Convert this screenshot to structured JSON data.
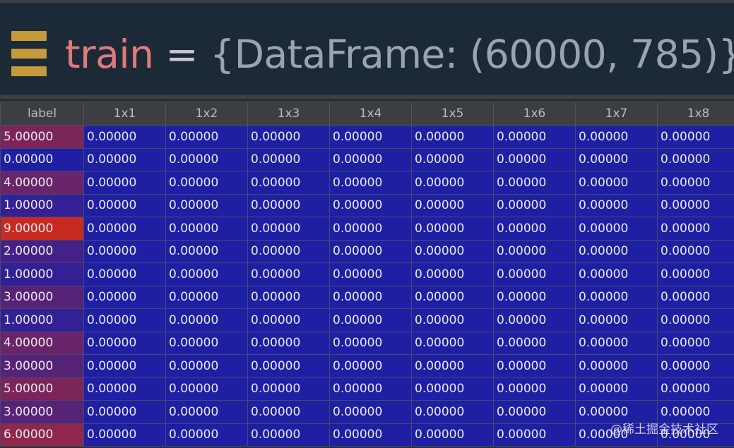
{
  "header": {
    "var_name": "train",
    "operator": "=",
    "value": "{DataFrame: (60000, 785)}"
  },
  "grid": {
    "columns": [
      "label",
      "1x1",
      "1x2",
      "1x3",
      "1x4",
      "1x5",
      "1x6",
      "1x7",
      "1x8"
    ],
    "rows": [
      [
        "5.00000",
        "0.00000",
        "0.00000",
        "0.00000",
        "0.00000",
        "0.00000",
        "0.00000",
        "0.00000",
        "0.00000"
      ],
      [
        "0.00000",
        "0.00000",
        "0.00000",
        "0.00000",
        "0.00000",
        "0.00000",
        "0.00000",
        "0.00000",
        "0.00000"
      ],
      [
        "4.00000",
        "0.00000",
        "0.00000",
        "0.00000",
        "0.00000",
        "0.00000",
        "0.00000",
        "0.00000",
        "0.00000"
      ],
      [
        "1.00000",
        "0.00000",
        "0.00000",
        "0.00000",
        "0.00000",
        "0.00000",
        "0.00000",
        "0.00000",
        "0.00000"
      ],
      [
        "9.00000",
        "0.00000",
        "0.00000",
        "0.00000",
        "0.00000",
        "0.00000",
        "0.00000",
        "0.00000",
        "0.00000"
      ],
      [
        "2.00000",
        "0.00000",
        "0.00000",
        "0.00000",
        "0.00000",
        "0.00000",
        "0.00000",
        "0.00000",
        "0.00000"
      ],
      [
        "1.00000",
        "0.00000",
        "0.00000",
        "0.00000",
        "0.00000",
        "0.00000",
        "0.00000",
        "0.00000",
        "0.00000"
      ],
      [
        "3.00000",
        "0.00000",
        "0.00000",
        "0.00000",
        "0.00000",
        "0.00000",
        "0.00000",
        "0.00000",
        "0.00000"
      ],
      [
        "1.00000",
        "0.00000",
        "0.00000",
        "0.00000",
        "0.00000",
        "0.00000",
        "0.00000",
        "0.00000",
        "0.00000"
      ],
      [
        "4.00000",
        "0.00000",
        "0.00000",
        "0.00000",
        "0.00000",
        "0.00000",
        "0.00000",
        "0.00000",
        "0.00000"
      ],
      [
        "3.00000",
        "0.00000",
        "0.00000",
        "0.00000",
        "0.00000",
        "0.00000",
        "0.00000",
        "0.00000",
        "0.00000"
      ],
      [
        "5.00000",
        "0.00000",
        "0.00000",
        "0.00000",
        "0.00000",
        "0.00000",
        "0.00000",
        "0.00000",
        "0.00000"
      ],
      [
        "3.00000",
        "0.00000",
        "0.00000",
        "0.00000",
        "0.00000",
        "0.00000",
        "0.00000",
        "0.00000",
        "0.00000"
      ],
      [
        "6.00000",
        "0.00000",
        "0.00000",
        "0.00000",
        "0.00000",
        "0.00000",
        "0.00000",
        "0.00000",
        "0.00000"
      ]
    ],
    "colors": {
      "low": "#1f1fa3",
      "high": "#c72a20"
    }
  },
  "watermark": "@稀土掘金技术社区"
}
